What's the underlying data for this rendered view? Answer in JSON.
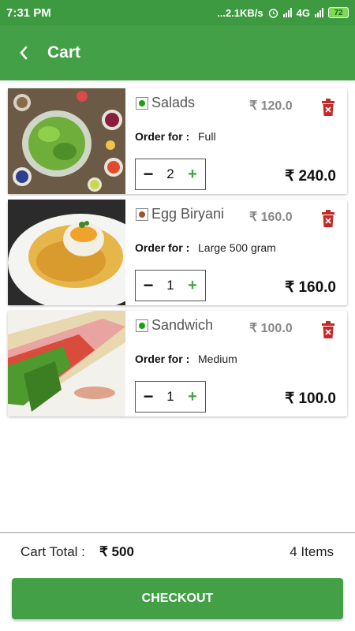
{
  "status_bar": {
    "time": "7:31 PM",
    "speed": "...2.1KB/s",
    "network": "4G",
    "battery": "72"
  },
  "app_bar": {
    "title": "Cart",
    "back_icon": "chevron-left-icon"
  },
  "cart_items": [
    {
      "name": "Salads",
      "diet": "veg",
      "diet_color": "#1aa10e",
      "unit_price": "₹ 120.0",
      "order_for_label": "Order for :",
      "order_for_value": "Full",
      "quantity": "2",
      "total": "₹ 240.0"
    },
    {
      "name": "Egg Biryani",
      "diet": "non-veg",
      "diet_color": "#a0522d",
      "unit_price": "₹ 160.0",
      "order_for_label": "Order for :",
      "order_for_value": "Large 500 gram",
      "quantity": "1",
      "total": "₹ 160.0"
    },
    {
      "name": "Sandwich",
      "diet": "veg",
      "diet_color": "#1aa10e",
      "unit_price": "₹ 100.0",
      "order_for_label": "Order for :",
      "order_for_value": "Medium",
      "quantity": "1",
      "total": "₹ 100.0"
    }
  ],
  "stepper": {
    "minus": "−",
    "plus": "+"
  },
  "footer": {
    "cart_total_label": "Cart Total :",
    "cart_total_value": "₹ 500",
    "items_count": "4  Items",
    "checkout_label": "CHECKOUT"
  },
  "colors": {
    "primary": "#43a047",
    "status_bar": "#3d9a40",
    "delete": "#c62828"
  }
}
